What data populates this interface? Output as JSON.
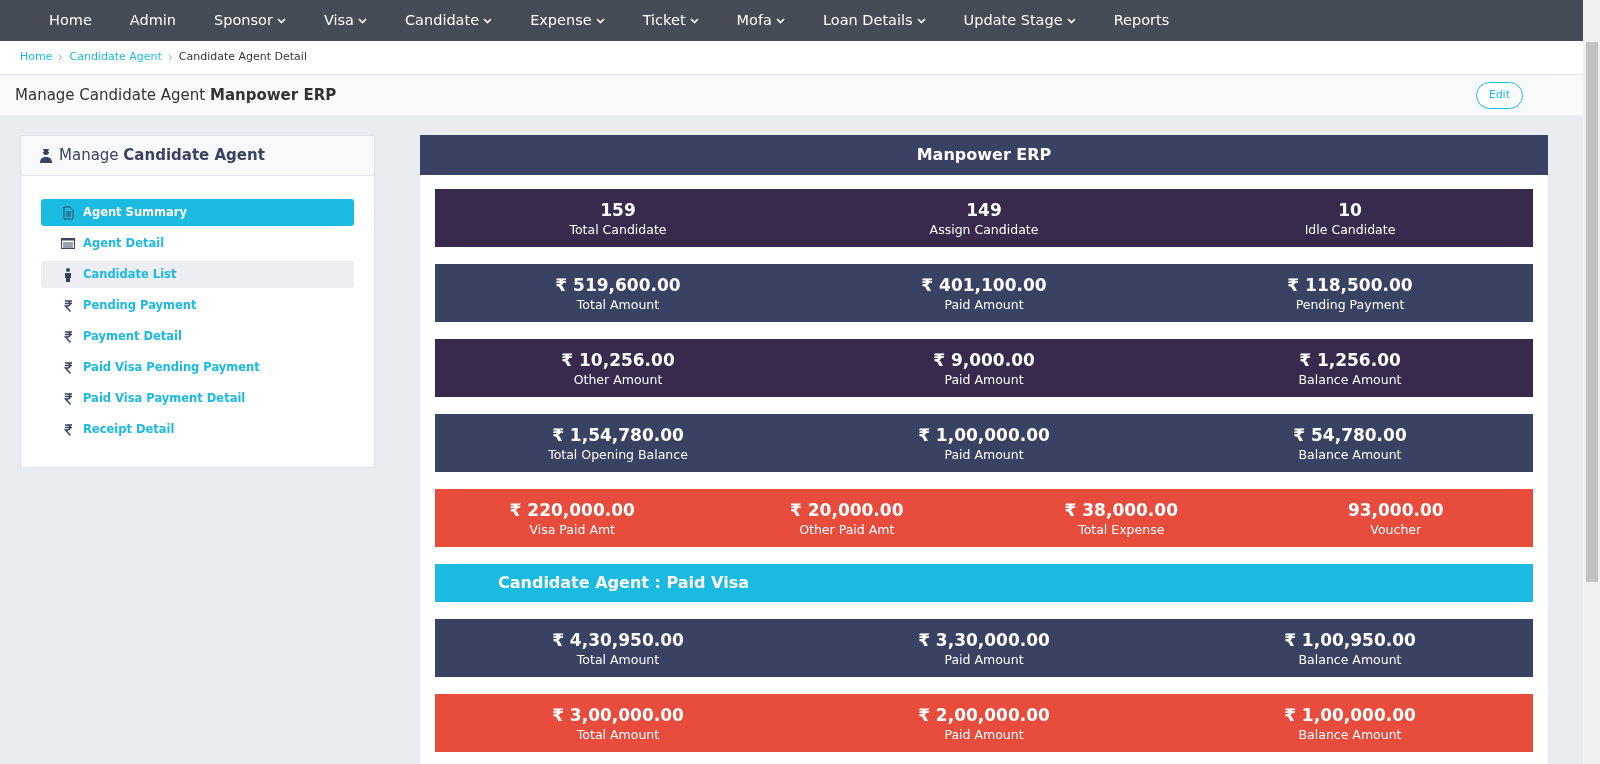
{
  "nav": [
    {
      "label": "Home",
      "dropdown": false
    },
    {
      "label": "Admin",
      "dropdown": false
    },
    {
      "label": "Sponsor",
      "dropdown": true
    },
    {
      "label": "Visa",
      "dropdown": true
    },
    {
      "label": "Candidate",
      "dropdown": true
    },
    {
      "label": "Expense",
      "dropdown": true
    },
    {
      "label": "Ticket",
      "dropdown": true
    },
    {
      "label": "Mofa",
      "dropdown": true
    },
    {
      "label": "Loan Details",
      "dropdown": true
    },
    {
      "label": "Update Stage",
      "dropdown": true
    },
    {
      "label": "Reports",
      "dropdown": false
    }
  ],
  "breadcrumb": [
    {
      "label": "Home",
      "link": true
    },
    {
      "label": "Candidate Agent",
      "link": true
    },
    {
      "label": "Candidate Agent Detail",
      "link": false
    }
  ],
  "page_header": {
    "title": "Manage Candidate Agent",
    "title_bold": "Manpower ERP",
    "edit_button": "Edit"
  },
  "sidebar": {
    "title": "Manage",
    "title_bold": "Candidate Agent",
    "items": [
      {
        "label": "Agent Summary",
        "kind": "document",
        "selected": true,
        "hovered": false
      },
      {
        "label": "Agent Detail",
        "kind": "list",
        "selected": false,
        "hovered": false
      },
      {
        "label": "Candidate List",
        "kind": "person",
        "selected": false,
        "hovered": true
      },
      {
        "label": "Pending Payment",
        "kind": "rupee",
        "selected": false,
        "hovered": false
      },
      {
        "label": "Payment Detail",
        "kind": "rupee",
        "selected": false,
        "hovered": false
      },
      {
        "label": "Paid Visa Pending Payment",
        "kind": "rupee",
        "selected": false,
        "hovered": false
      },
      {
        "label": "Paid Visa Payment Detail",
        "kind": "rupee",
        "selected": false,
        "hovered": false
      },
      {
        "label": "Receipt Detail",
        "kind": "rupee",
        "selected": false,
        "hovered": false
      }
    ]
  },
  "panel": {
    "title": "Manpower ERP",
    "rows": [
      {
        "kind": "stats",
        "color": "#372a4d",
        "items": [
          {
            "value": "159",
            "label": "Total Candidate"
          },
          {
            "value": "149",
            "label": "Assign Candidate"
          },
          {
            "value": "10",
            "label": "Idle Candidate"
          }
        ]
      },
      {
        "kind": "stats",
        "color": "#3a4263",
        "items": [
          {
            "value": "₹ 519,600.00",
            "label": "Total Amount"
          },
          {
            "value": "₹ 401,100.00",
            "label": "Paid Amount"
          },
          {
            "value": "₹ 118,500.00",
            "label": "Pending Payment"
          }
        ]
      },
      {
        "kind": "stats",
        "color": "#372a4d",
        "items": [
          {
            "value": "₹ 10,256.00",
            "label": "Other Amount"
          },
          {
            "value": "₹ 9,000.00",
            "label": "Paid Amount"
          },
          {
            "value": "₹ 1,256.00",
            "label": "Balance Amount"
          }
        ]
      },
      {
        "kind": "stats",
        "color": "#3a4263",
        "items": [
          {
            "value": "₹ 1,54,780.00",
            "label": "Total Opening Balance"
          },
          {
            "value": "₹ 1,00,000.00",
            "label": "Paid Amount"
          },
          {
            "value": "₹ 54,780.00",
            "label": "Balance Amount"
          }
        ]
      },
      {
        "kind": "stats",
        "color": "#e74c3c",
        "items": [
          {
            "value": "₹ 220,000.00",
            "label": "Visa Paid Amt"
          },
          {
            "value": "₹ 20,000.00",
            "label": "Other Paid Amt"
          },
          {
            "value": "₹ 38,000.00",
            "label": "Total Expense"
          },
          {
            "value": "93,000.00",
            "label": "Voucher"
          }
        ]
      },
      {
        "kind": "heading",
        "color": "#1bbae1",
        "title": "Candidate Agent : Paid Visa"
      },
      {
        "kind": "stats",
        "color": "#3a4263",
        "items": [
          {
            "value": "₹ 4,30,950.00",
            "label": "Total Amount"
          },
          {
            "value": "₹ 3,30,000.00",
            "label": "Paid Amount"
          },
          {
            "value": "₹ 1,00,950.00",
            "label": "Balance Amount"
          }
        ]
      },
      {
        "kind": "stats",
        "color": "#e74c3c",
        "items": [
          {
            "value": "₹ 3,00,000.00",
            "label": "Total Amount"
          },
          {
            "value": "₹ 2,00,000.00",
            "label": "Paid Amount"
          },
          {
            "value": "₹ 1,00,000.00",
            "label": "Balance Amount"
          }
        ]
      }
    ]
  }
}
